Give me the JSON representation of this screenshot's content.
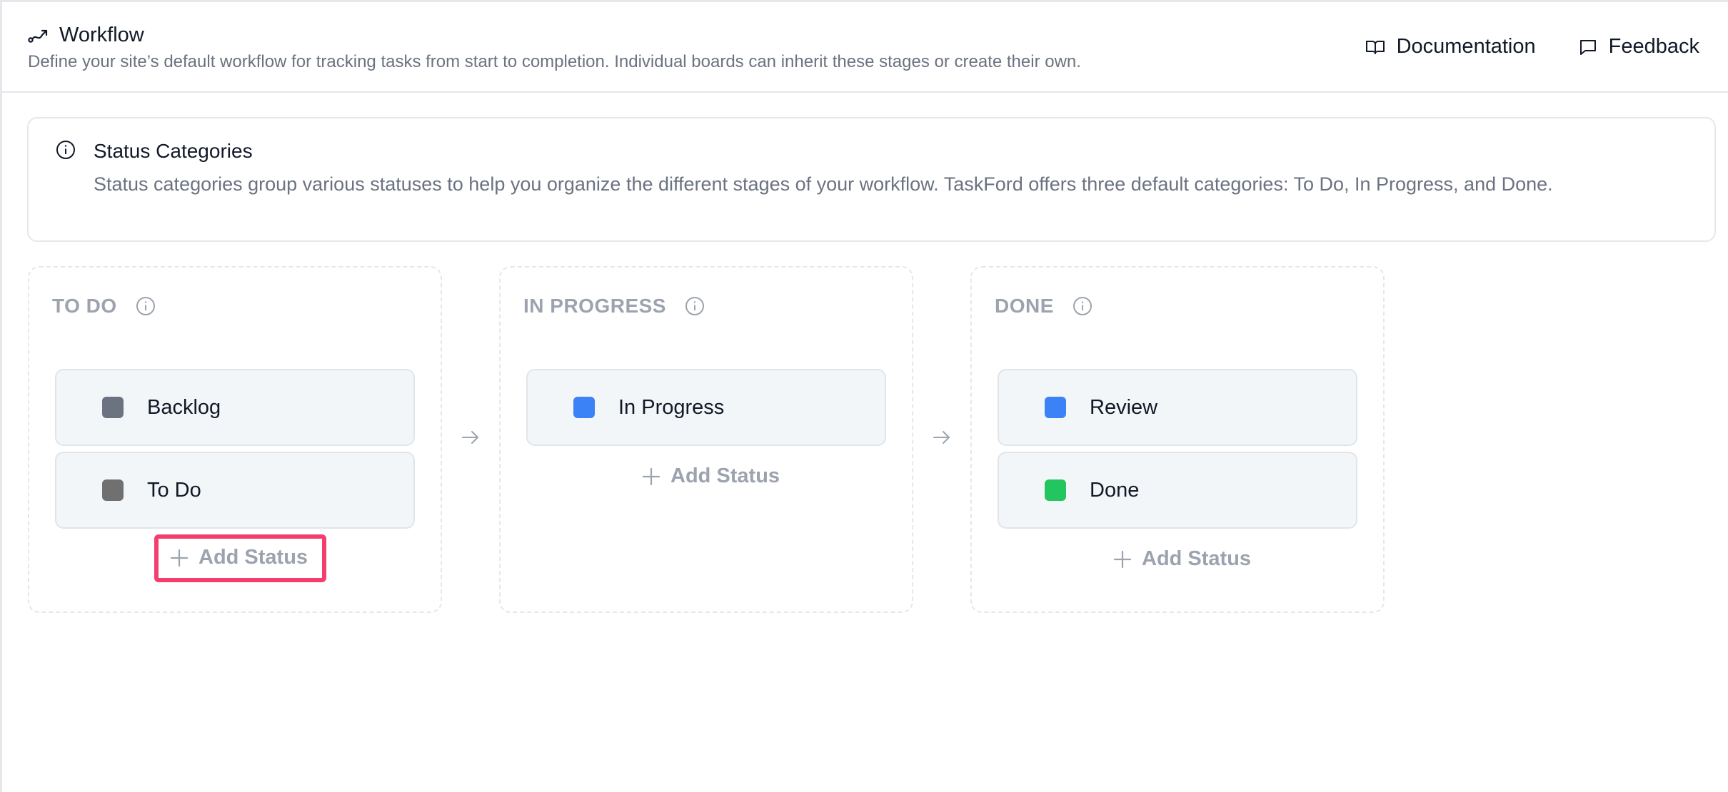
{
  "header": {
    "title": "Workflow",
    "subtitle": "Define your site’s default workflow for tracking tasks from start to completion. Individual boards can inherit these stages or create their own.",
    "links": {
      "documentation": "Documentation",
      "feedback": "Feedback"
    }
  },
  "info": {
    "title": "Status Categories",
    "text": "Status categories group various statuses to help you organize the different stages of your workflow. TaskFord offers three default categories: To Do, In Progress, and Done."
  },
  "columns": {
    "todo": {
      "label": "TO DO",
      "statuses": [
        {
          "name": "Backlog",
          "color": "#6b7280"
        },
        {
          "name": "To Do",
          "color": "#707070"
        }
      ],
      "add_label": "Add Status"
    },
    "in_progress": {
      "label": "IN PROGRESS",
      "statuses": [
        {
          "name": "In Progress",
          "color": "#3b82f6"
        }
      ],
      "add_label": "Add Status"
    },
    "done": {
      "label": "DONE",
      "statuses": [
        {
          "name": "Review",
          "color": "#3b82f6"
        },
        {
          "name": "Done",
          "color": "#22c55e"
        }
      ],
      "add_label": "Add Status"
    }
  },
  "colors": {
    "highlight": "#f43f6e",
    "muted": "#9ca3af"
  }
}
